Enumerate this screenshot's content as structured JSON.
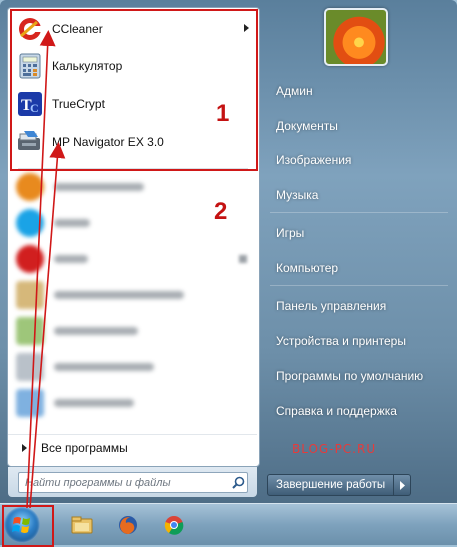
{
  "pinned": [
    {
      "label": "CCleaner",
      "icon": "ccleaner-icon",
      "has_submenu": true
    },
    {
      "label": "Калькулятор",
      "icon": "calculator-icon",
      "has_submenu": false
    },
    {
      "label": "TrueCrypt",
      "icon": "truecrypt-icon",
      "has_submenu": false
    },
    {
      "label": "MP Navigator EX 3.0",
      "icon": "mp-navigator-icon",
      "has_submenu": false
    }
  ],
  "all_programs": "Все программы",
  "search": {
    "placeholder": "Найти программы и файлы"
  },
  "right_items": [
    "Админ",
    "Документы",
    "Изображения",
    "Музыка",
    "Игры",
    "Компьютер",
    "Панель управления",
    "Устройства и принтеры",
    "Программы по умолчанию",
    "Справка и поддержка"
  ],
  "shutdown_label": "Завершение работы",
  "watermark": "BLOG-PC.RU",
  "annotations": {
    "one": "1",
    "two": "2"
  },
  "taskbar": [
    "start-orb",
    "explorer-icon",
    "firefox-icon",
    "chrome-icon"
  ],
  "colors": {
    "annotation": "#d01818",
    "frame": "#6d8fa9"
  }
}
